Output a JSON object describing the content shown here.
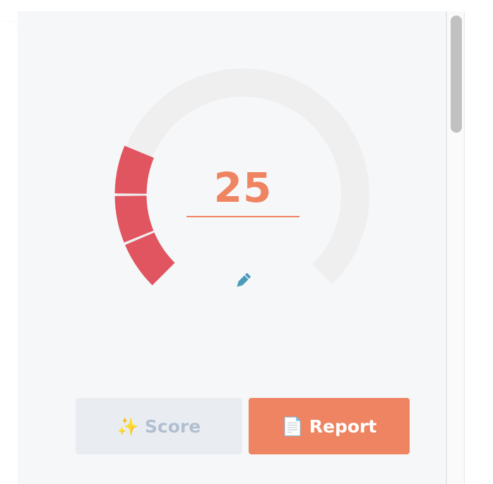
{
  "gauge": {
    "value": "25",
    "value_fraction": 0.25,
    "fill_color": "#e05560",
    "track_color": "#efefef"
  },
  "value_accent_color": "#ef8461",
  "edit_icon": "pencil-icon",
  "buttons": {
    "score": {
      "icon": "✨",
      "label": "Score"
    },
    "report": {
      "icon": "📄",
      "label": "Report"
    }
  }
}
